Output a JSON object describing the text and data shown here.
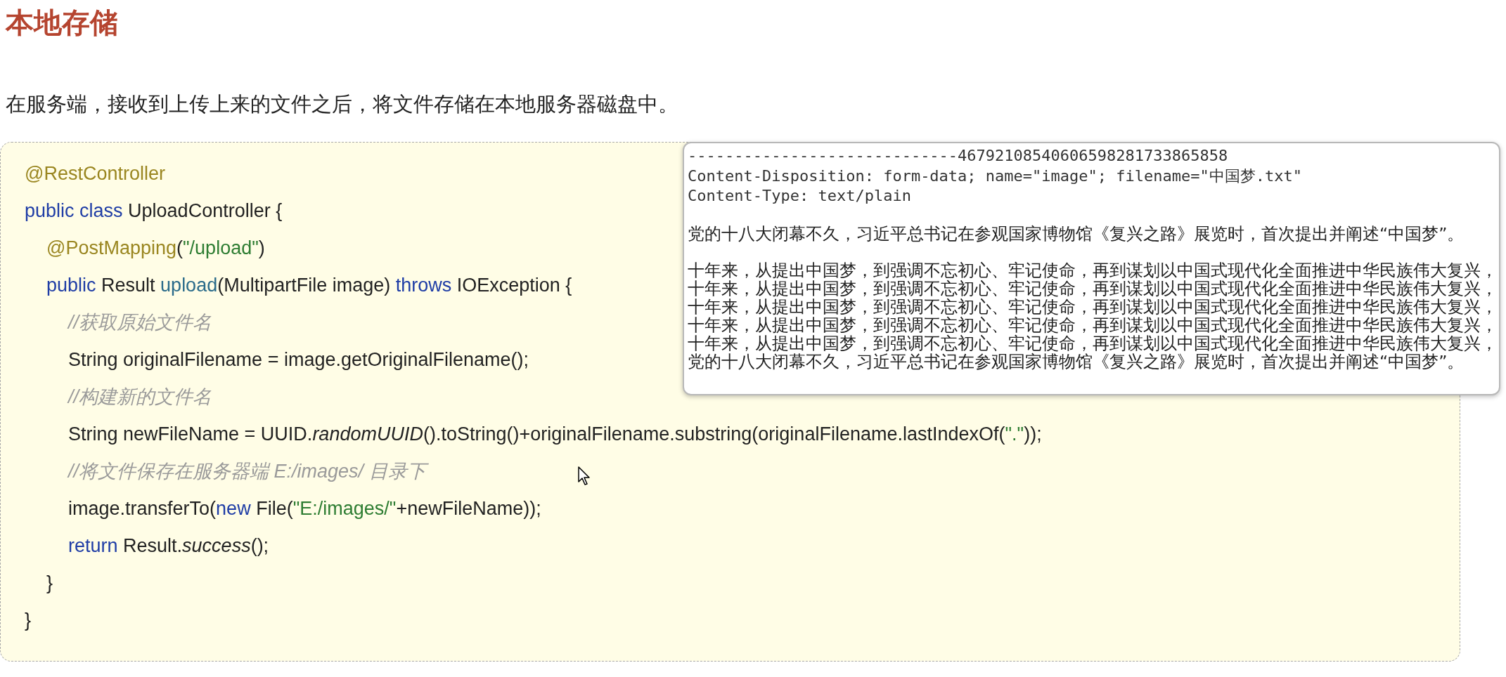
{
  "title": "本地存储",
  "description": "在服务端，接收到上传上来的文件之后，将文件存储在本地服务器磁盘中。",
  "code": {
    "lines": [
      {
        "tokens": [
          {
            "kind": "annotation",
            "text": "@RestController"
          }
        ]
      },
      {
        "tokens": [
          {
            "kind": "keyword",
            "text": "public class "
          },
          {
            "kind": "plain",
            "text": "UploadController {"
          }
        ],
        "children": [
          {
            "tokens": [
              {
                "kind": "annotation",
                "text": "@PostMapping"
              },
              {
                "kind": "plain",
                "text": "("
              },
              {
                "kind": "string",
                "text": "\"/upload\""
              },
              {
                "kind": "plain",
                "text": ")"
              }
            ]
          },
          {
            "tokens": [
              {
                "kind": "keyword",
                "text": "public "
              },
              {
                "kind": "plain",
                "text": "Result "
              },
              {
                "kind": "method",
                "text": "upload"
              },
              {
                "kind": "plain",
                "text": "(MultipartFile image) "
              },
              {
                "kind": "keyword",
                "text": "throws "
              },
              {
                "kind": "plain",
                "text": "IOException {"
              }
            ],
            "children": [
              {
                "tokens": [
                  {
                    "kind": "comment",
                    "text": "//获取原始文件名"
                  }
                ]
              },
              {
                "tokens": [
                  {
                    "kind": "plain",
                    "text": "String originalFilename = image.getOriginalFilename();"
                  }
                ]
              },
              {
                "tokens": [
                  {
                    "kind": "comment",
                    "text": "//构建新的文件名"
                  }
                ]
              },
              {
                "tokens": [
                  {
                    "kind": "plain",
                    "text": "String newFileName = UUID."
                  },
                  {
                    "kind": "italic",
                    "text": "randomUUID"
                  },
                  {
                    "kind": "plain",
                    "text": "().toString()+originalFilename.substring(originalFilename.lastIndexOf("
                  },
                  {
                    "kind": "string",
                    "text": "\".\""
                  },
                  {
                    "kind": "plain",
                    "text": "));"
                  }
                ]
              },
              {
                "tokens": [
                  {
                    "kind": "comment",
                    "text": "//将文件保存在服务器端 E:/images/ 目录下"
                  }
                ]
              },
              {
                "tokens": [
                  {
                    "kind": "plain",
                    "text": "image.transferTo("
                  },
                  {
                    "kind": "keyword",
                    "text": "new "
                  },
                  {
                    "kind": "plain",
                    "text": "File("
                  },
                  {
                    "kind": "string",
                    "text": "\"E:/images/\""
                  },
                  {
                    "kind": "plain",
                    "text": "+newFileName));"
                  }
                ]
              },
              {
                "tokens": [
                  {
                    "kind": "keyword",
                    "text": "return "
                  },
                  {
                    "kind": "plain",
                    "text": "Result."
                  },
                  {
                    "kind": "italic",
                    "text": "success"
                  },
                  {
                    "kind": "plain",
                    "text": "();"
                  }
                ]
              }
            ]
          },
          {
            "tokens": [
              {
                "kind": "plain",
                "text": "}"
              }
            ]
          }
        ]
      },
      {
        "tokens": [
          {
            "kind": "plain",
            "text": "}"
          }
        ]
      }
    ]
  },
  "request_popup": {
    "header_lines": [
      "-----------------------------46792108540606598281733865858",
      "Content-Disposition: form-data; name=\"image\"; filename=\"中国梦.txt\"",
      "Content-Type: text/plain"
    ],
    "paragraphs": [
      [
        "党的十八大闭幕不久，习近平总书记在参观国家博物馆《复兴之路》展览时，首次提出并阐述“中国梦”。"
      ],
      [
        "十年来，从提出中国梦，到强调不忘初心、牢记使命，再到谋划以中国式现代化全面推进中华民族伟大复兴，",
        "十年来，从提出中国梦，到强调不忘初心、牢记使命，再到谋划以中国式现代化全面推进中华民族伟大复兴，",
        "十年来，从提出中国梦，到强调不忘初心、牢记使命，再到谋划以中国式现代化全面推进中华民族伟大复兴，",
        "十年来，从提出中国梦，到强调不忘初心、牢记使命，再到谋划以中国式现代化全面推进中华民族伟大复兴，",
        "十年来，从提出中国梦，到强调不忘初心、牢记使命，再到谋划以中国式现代化全面推进中华民族伟大复兴，",
        "党的十八大闭幕不久，习近平总书记在参观国家博物馆《复兴之路》展览时，首次提出并阐述“中国梦”。"
      ]
    ]
  }
}
